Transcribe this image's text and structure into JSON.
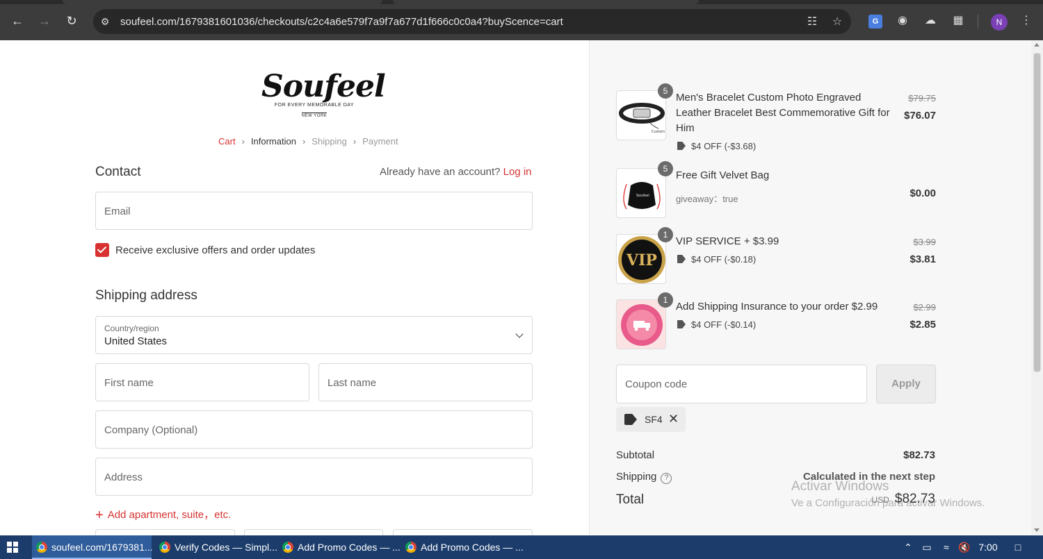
{
  "browser": {
    "url": "soufeel.com/1679381601036/checkouts/c2c4a6e579f7a9f7a677d1f666c0c0a4?buyScence=cart",
    "profile_initial": "N",
    "icons": [
      "back-icon",
      "forward-icon",
      "reload-icon",
      "site-info-icon",
      "translate-icon",
      "bookmark-star-icon",
      "google-translate-ext-icon",
      "globe-ext-icon",
      "cloud-ext-icon",
      "extensions-icon",
      "menu-icon"
    ]
  },
  "brand": {
    "logo_text": "Soufeel",
    "tagline": "FOR EVERY MEMORABLE DAY",
    "city": "NEW YORK",
    "accent_color": "#d73131"
  },
  "breadcrumb": {
    "cart": "Cart",
    "information": "Information",
    "shipping": "Shipping",
    "payment": "Payment"
  },
  "contact": {
    "title": "Contact",
    "account_prompt": "Already have an account?",
    "login_link": "Log in",
    "email_placeholder": "Email",
    "offers_label": "Receive exclusive offers and order updates",
    "offers_checked": true
  },
  "shipping_address": {
    "title": "Shipping address",
    "country_label": "Country/region",
    "country_value": "United States",
    "first_name_placeholder": "First name",
    "last_name_placeholder": "Last name",
    "company_placeholder": "Company (Optional)",
    "address_placeholder": "Address",
    "add_apartment": "Add apartment, suite，etc."
  },
  "order": {
    "items": [
      {
        "title": "Men's Bracelet Custom Photo Engraved Leather Bracelet Best Commemorative Gift for Him",
        "qty": "5",
        "discount": "$4 OFF (-$3.68)",
        "old_price": "$79.75",
        "price": "$76.07"
      },
      {
        "title": "Free Gift Velvet Bag",
        "qty": "5",
        "sub": "giveaway：true",
        "price": "$0.00"
      },
      {
        "title": "VIP SERVICE + $3.99",
        "qty": "1",
        "discount": "$4 OFF (-$0.18)",
        "old_price": "$3.99",
        "price": "$3.81",
        "thumb_text": "VIP"
      },
      {
        "title": "Add Shipping Insurance to your order $2.99",
        "qty": "1",
        "discount": "$4 OFF (-$0.14)",
        "old_price": "$2.99",
        "price": "$2.85"
      }
    ],
    "coupon_placeholder": "Coupon code",
    "apply_label": "Apply",
    "applied_code": "SF4",
    "subtotal_label": "Subtotal",
    "subtotal_value": "$82.73",
    "shipping_label": "Shipping",
    "shipping_value": "Calculated in the next step",
    "total_label": "Total",
    "total_currency": "USD",
    "total_value": "$82.73"
  },
  "watermark": {
    "line1": "Activar Windows",
    "line2": "Ve a Configuración para activar Windows."
  },
  "taskbar": {
    "apps": [
      "soufeel.com/1679381...",
      "Verify Codes — Simpl...",
      "Add Promo Codes — ...",
      "Add Promo Codes — ..."
    ],
    "time": "7:00"
  }
}
